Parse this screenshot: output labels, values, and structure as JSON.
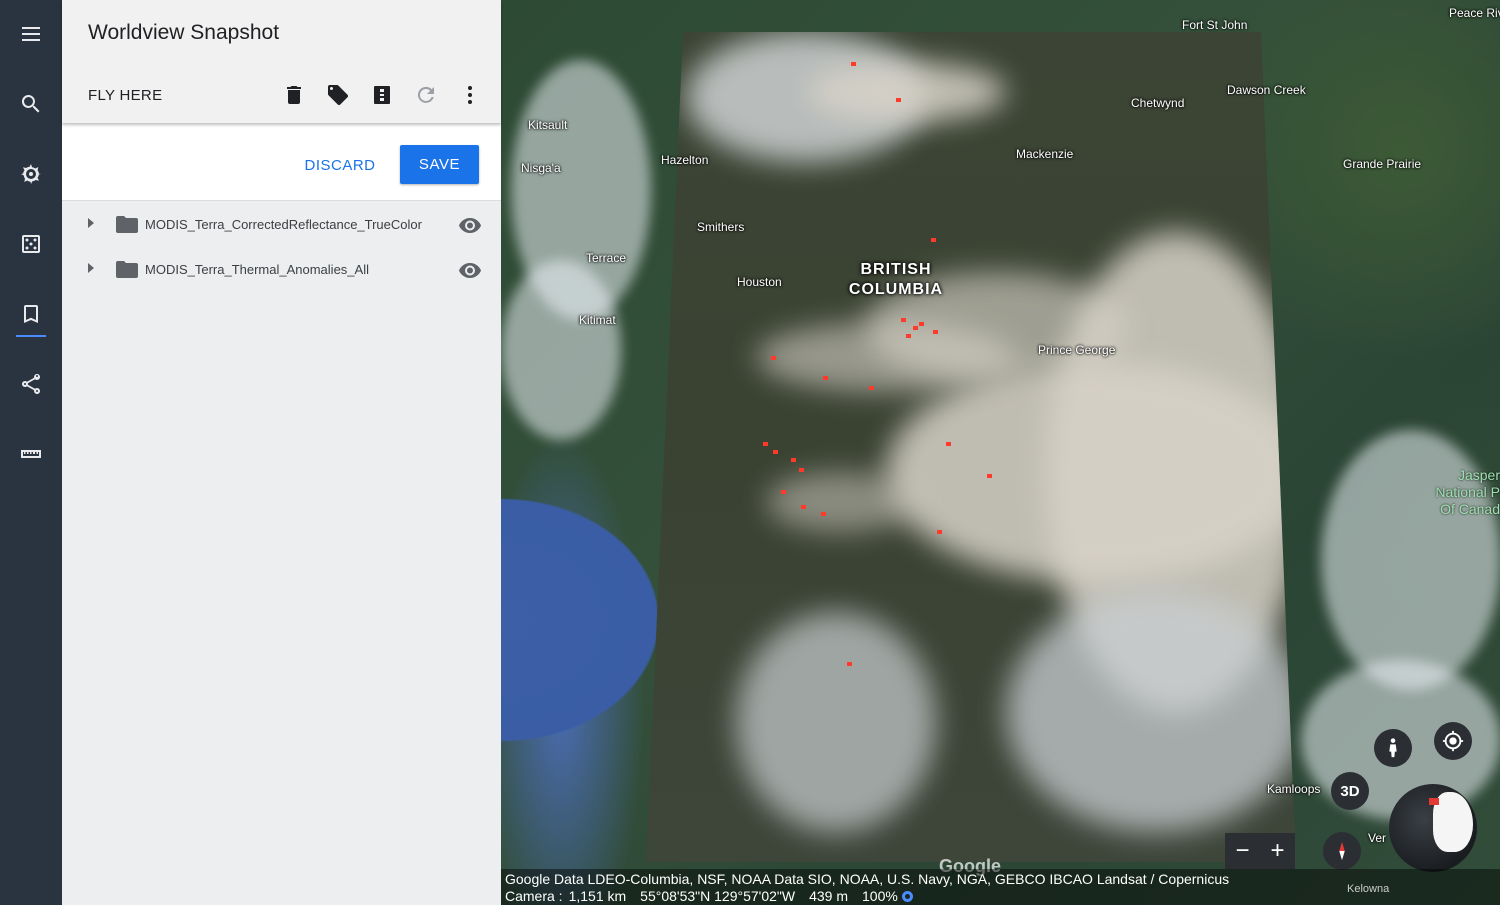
{
  "rail": {
    "items": [
      "menu",
      "search",
      "voyager",
      "feeling-lucky",
      "projects",
      "share",
      "measure"
    ]
  },
  "panel": {
    "title": "Worldview Snapshot",
    "fly_here": "FLY HERE",
    "discard_label": "DISCARD",
    "save_label": "SAVE",
    "layers": [
      {
        "name": "MODIS_Terra_CorrectedReflectance_TrueColor",
        "visible": true
      },
      {
        "name": "MODIS_Terra_Thermal_Anomalies_All",
        "visible": true
      }
    ]
  },
  "map": {
    "labels": {
      "fort_st_john": "Fort St John",
      "peace_river": "Peace Riv",
      "dawson_creek": "Dawson Creek",
      "chetwynd": "Chetwynd",
      "kitsault": "Kitsault",
      "nisgaa": "Nisga'a",
      "hazelton": "Hazelton",
      "mackenzie": "Mackenzie",
      "grande_prairie": "Grande Prairie",
      "smithers": "Smithers",
      "terrace": "Terrace",
      "houston": "Houston",
      "kitimat": "Kitimat",
      "prince_george": "Prince George",
      "kamloops": "Kamloops",
      "vernon": "Ver",
      "kelowna": "Kelowna"
    },
    "region": {
      "line1": "BRITISH",
      "line2": "COLUMBIA"
    },
    "park": {
      "line1": "Jasper",
      "line2": "National P",
      "line3": "Of Canad"
    },
    "btn_3d": "3D",
    "zoom_out": "−",
    "zoom_in": "+",
    "google_logo": "Google"
  },
  "status": {
    "attribution": "Google Data LDEO-Columbia, NSF, NOAA Data SIO, NOAA, U.S. Navy, NGA, GEBCO IBCAO Landsat / Copernicus",
    "camera_label": "Camera :",
    "camera_distance": "1,151 km",
    "coordinates": "55°08'53\"N 129°57'02\"W",
    "elevation": "439 m",
    "loaded": "100%"
  },
  "colors": {
    "rail_bg": "#2a3340",
    "accent": "#1a73e8",
    "fire": "#ff3a2a"
  }
}
